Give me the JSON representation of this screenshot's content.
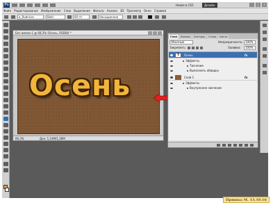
{
  "app": {
    "logo": "Ps",
    "workspace_label": "Новое в CS5",
    "workspace_button": "Дизайн"
  },
  "menu": [
    "Файл",
    "Редактирование",
    "Изображение",
    "Слои",
    "Выделение",
    "Фильтр",
    "Анализ",
    "3D",
    "Просмотр",
    "Окно",
    "Справка"
  ],
  "options": {
    "font": "a_Rubricon",
    "size": "60 пт",
    "style": "Bold",
    "antialias": "Насыщенное"
  },
  "document": {
    "title": "Без имени-1 @ 68,3% (Осень, RGB/8) *",
    "canvas_text": "Осень",
    "zoom": "66,3%",
    "doc_info": "Док: 1,14M/1,36M"
  },
  "layers_panel": {
    "tabs": [
      "Слои",
      "Каналы",
      "Контуры",
      "Стили",
      "Кисти"
    ],
    "blend_mode": "Обычные",
    "opacity_label": "Непрозрачность:",
    "opacity": "100%",
    "lock_label": "Закрепить:",
    "fill_label": "Заливка:",
    "fill": "100%",
    "layers": [
      {
        "thumb": "T",
        "name": "Осень",
        "fx": "fx",
        "active": true
      },
      {
        "thumb": "",
        "name": "Слой 1",
        "fx": "fx",
        "active": false
      }
    ],
    "effects_label": "Эффекты",
    "layer1_effects": [
      "Тиснение",
      "Выполнить обводку"
    ],
    "layer2_effects": [
      "Внутреннее свечение"
    ]
  },
  "watermark": "Пришка М. 13.10.16",
  "colors": {
    "canvas": "#7e5634",
    "text_fill": "#f2b53c",
    "text_outline": "#3d2208",
    "active_layer": "#3b6fb0",
    "arrow": "#e02020"
  }
}
